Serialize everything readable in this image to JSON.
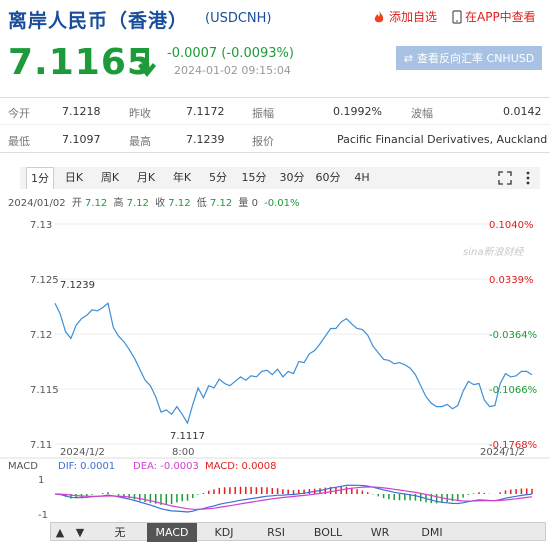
{
  "header": {
    "title": "离岸人民币（香港）",
    "code": "(USDCNH)",
    "add_fav": "添加自选",
    "app_view": "在APP中查看"
  },
  "quote": {
    "price": "7.1165",
    "change": "-0.0007 (-0.0093%)",
    "timestamp": "2024-01-02 09:15:04",
    "reverse_button": "查看反向汇率 CNHUSD"
  },
  "stats": {
    "row1": [
      {
        "label": "今开",
        "value": "7.1218"
      },
      {
        "label": "昨收",
        "value": "7.1172"
      },
      {
        "label": "振幅",
        "value": "0.1992%"
      },
      {
        "label": "波幅",
        "value": "0.0142"
      }
    ],
    "row2": [
      {
        "label": "最低",
        "value": "7.1097"
      },
      {
        "label": "最高",
        "value": "7.1239"
      },
      {
        "label": "报价",
        "value": "Pacific Financial Derivatives, Auckland"
      }
    ]
  },
  "period_tabs": [
    "1分",
    "日K",
    "周K",
    "月K",
    "年K",
    "5分",
    "15分",
    "30分",
    "60分",
    "4H"
  ],
  "active_period": "1分",
  "chart_info": {
    "date": "2024/01/02",
    "items": [
      {
        "label": "开",
        "value": "7.12"
      },
      {
        "label": "高",
        "value": "7.12"
      },
      {
        "label": "收",
        "value": "7.12"
      },
      {
        "label": "低",
        "value": "7.12"
      },
      {
        "label": "量",
        "value": "0"
      },
      {
        "label": "",
        "value": "-0.01%"
      }
    ],
    "watermark": "sina新浪财经",
    "max_label": "7.1239",
    "min_label": "7.1117",
    "x_start": "2024/1/2",
    "x_mid": "8:00",
    "x_end": "2024/1/2"
  },
  "macd": {
    "name": "MACD",
    "dif": "DIF: 0.0001",
    "dea": "DEA: -0.0003",
    "macd": "MACD: 0.0008",
    "ticks": [
      "1",
      "-1"
    ]
  },
  "indicator_tabs": [
    "无",
    "MACD",
    "KDJ",
    "RSI",
    "BOLL",
    "WR",
    "DMI"
  ],
  "active_indicator": "MACD",
  "colors": {
    "up": "#e02020",
    "down": "#1d9b3a",
    "line": "#3c8fd6",
    "dif": "#3c6fd6",
    "dea": "#d040d0",
    "brand": "#1a4e9c"
  },
  "chart_data": {
    "type": "line",
    "title": "",
    "xlabel": "",
    "ylabel": "",
    "ylim": [
      7.11,
      7.13
    ],
    "y_ticks": [
      "7.13",
      "7.125",
      "7.12",
      "7.115",
      "7.11"
    ],
    "pct_ticks": [
      "0.1040%",
      "0.0339%",
      "-0.0364%",
      "-0.1066%",
      "-0.1768%"
    ],
    "x_ticks": [
      "2024/1/2",
      "8:00",
      "2024/1/2"
    ],
    "series": [
      {
        "values": [
          7.1228,
          7.1218,
          7.1202,
          7.1196,
          7.1208,
          7.1214,
          7.1217,
          7.1222,
          7.1221,
          7.1224,
          7.1228,
          7.1206,
          7.1198,
          7.1193,
          7.1186,
          7.1178,
          7.1168,
          7.1158,
          7.1153,
          7.1143,
          7.1129,
          7.1131,
          7.1127,
          7.1134,
          7.1127,
          7.1119,
          7.1136,
          7.1151,
          7.1142,
          7.1153,
          7.1151,
          7.1159,
          7.1155,
          7.1153,
          7.1157,
          7.1161,
          7.1158,
          7.1162,
          7.1161,
          7.1166,
          7.1167,
          7.1163,
          7.1168,
          7.1161,
          7.1166,
          7.1164,
          7.1175,
          7.1174,
          7.1182,
          7.1185,
          7.1191,
          7.1198,
          7.1205,
          7.1205,
          7.1211,
          7.1214,
          7.1209,
          7.1205,
          7.1204,
          7.1199,
          7.1189,
          7.1183,
          7.1177,
          7.1176,
          7.1173,
          7.1174,
          7.1172,
          7.1169,
          7.1163,
          7.1153,
          7.1143,
          7.1137,
          7.1134,
          7.1134,
          7.1136,
          7.1132,
          7.1135,
          7.1148,
          7.1157,
          7.1154,
          7.1155,
          7.114,
          7.1134,
          7.1135,
          7.1155,
          7.1164,
          7.1161,
          7.1162,
          7.1166,
          7.1166,
          7.1163
        ]
      }
    ]
  }
}
